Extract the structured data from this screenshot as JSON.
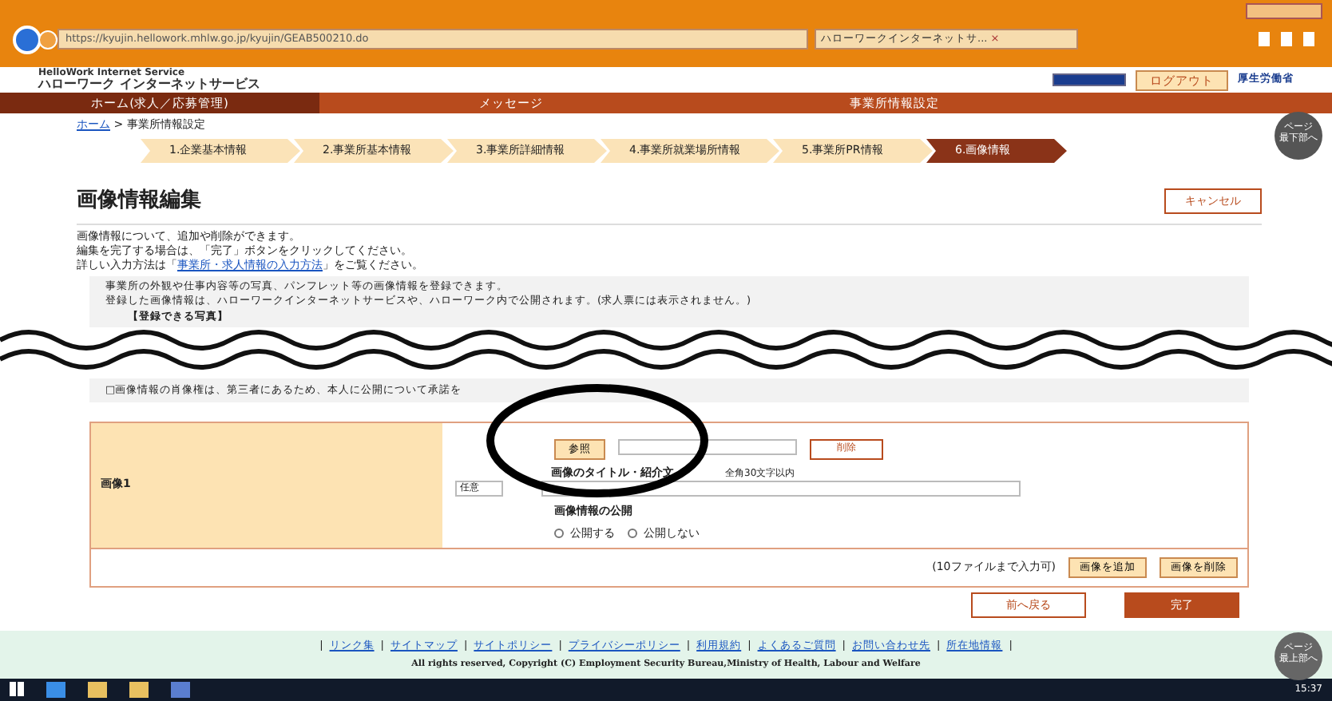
{
  "browser": {
    "url": "https://kyujin.hellowork.mhlw.go.jp/kyujin/GEAB500210.do",
    "tab": "ハローワークインターネットサ...",
    "tab_close": "×"
  },
  "header": {
    "logo_sub": "HelloWork Internet Service",
    "logo": "ハローワーク インターネットサービス",
    "logout": "ログアウト",
    "ministry": "厚生労働省"
  },
  "nav": [
    {
      "label": "ホーム(求人／応募管理)",
      "selected": true
    },
    {
      "label": "メッセージ",
      "selected": false
    },
    {
      "label": "事業所情報設定",
      "selected": false
    }
  ],
  "breadcrumb": {
    "link": "ホーム",
    "current": "> 事業所情報設定"
  },
  "steps": [
    {
      "label": "1.企業基本情報",
      "selected": false
    },
    {
      "label": "2.事業所基本情報",
      "selected": false
    },
    {
      "label": "3.事業所詳細情報",
      "selected": false
    },
    {
      "label": "4.事業所就業場所情報",
      "selected": false
    },
    {
      "label": "5.事業所PR情報",
      "selected": false
    },
    {
      "label": "6.画像情報",
      "selected": true
    }
  ],
  "page_nav_down": [
    "ページ",
    "最下部へ"
  ],
  "title": "画像情報編集",
  "cancel": "キャンセル",
  "intro": [
    "画像情報について、追加や削除ができます。",
    "編集を完了する場合は、「完了」ボタンをクリックしてください。"
  ],
  "intro_link_line": {
    "before": "詳しい入力方法は「",
    "link": "事業所・求人情報の入力方法",
    "after": "」をご覧ください。"
  },
  "notice": [
    "事業所の外観や仕事内容等の写真、パンフレット等の画像情報を登録できます。",
    "登録した画像情報は、ハローワークインターネットサービスや、ハローワーク内で公開されます。(求人票には表示されません。)",
    "【登録できる写真】"
  ],
  "notice_after_cut": "□画像情報の肖像権は、第三者にあるため、本人に公開について承諾を",
  "image_row": {
    "label": "画像1",
    "browse": "参照",
    "delete": "削除",
    "optional": "任意",
    "title_label": "画像のタイトル・紹介文",
    "title_hint": "全角30文字以内",
    "publish_label": "画像情報の公開",
    "radios": [
      {
        "label": "公開する",
        "checked": false
      },
      {
        "label": "公開しない",
        "checked": false
      }
    ]
  },
  "table_footer": {
    "note": "(10ファイルまで入力可)",
    "buttons": [
      "画像を追加",
      "画像を削除"
    ]
  },
  "back": "前へ戻る",
  "done": "完了",
  "footer": {
    "items": [
      {
        "kind": "separator",
        "text": "|"
      },
      {
        "kind": "link",
        "text": "リンク集"
      },
      {
        "kind": "separator",
        "text": "|"
      },
      {
        "kind": "link",
        "text": "サイトマップ"
      },
      {
        "kind": "separator",
        "text": "|"
      },
      {
        "kind": "link",
        "text": "サイトポリシー"
      },
      {
        "kind": "separator",
        "text": "|"
      },
      {
        "kind": "link",
        "text": "プライバシーポリシー"
      },
      {
        "kind": "separator",
        "text": "|"
      },
      {
        "kind": "link",
        "text": "利用規約"
      },
      {
        "kind": "separator",
        "text": "|"
      },
      {
        "kind": "link",
        "text": "よくあるご質問"
      },
      {
        "kind": "separator",
        "text": "|"
      },
      {
        "kind": "link",
        "text": "お問い合わせ先"
      },
      {
        "kind": "separator",
        "text": "|"
      },
      {
        "kind": "link",
        "text": "所在地情報"
      },
      {
        "kind": "separator",
        "text": "|"
      }
    ],
    "copyright": "All rights reserved, Copyright (C) Employment Security Bureau,Ministry of Health, Labour and Welfare"
  },
  "page_nav_up": [
    "ページ",
    "最上部へ"
  ],
  "taskbar": {
    "time": "15:37"
  }
}
